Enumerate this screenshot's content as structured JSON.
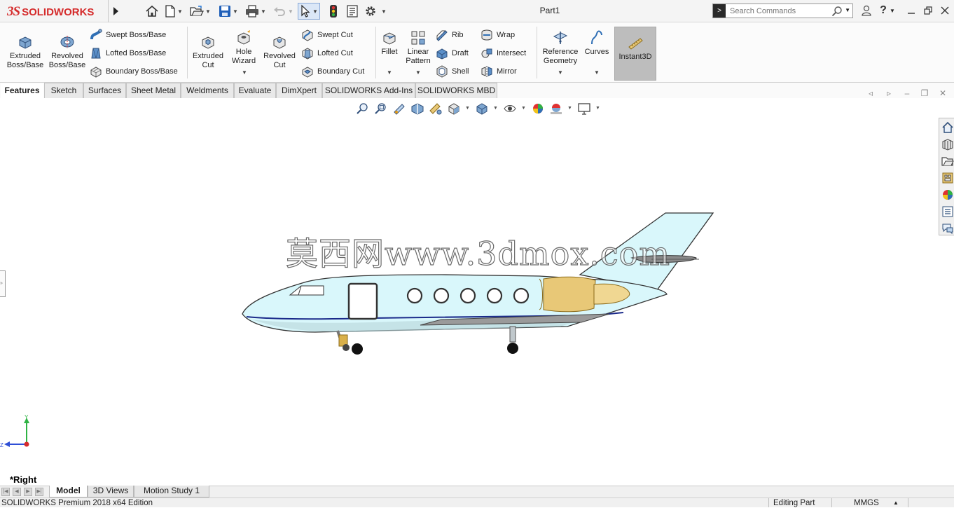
{
  "app": {
    "logo_ds": "3S",
    "logo_text": "SOLIDWORKS",
    "document_title": "Part1"
  },
  "search": {
    "placeholder": "Search Commands"
  },
  "ribbon": {
    "extruded_boss": "Extruded Boss/Base",
    "revolved_boss": "Revolved Boss/Base",
    "swept_boss": "Swept Boss/Base",
    "lofted_boss": "Lofted Boss/Base",
    "boundary_boss": "Boundary Boss/Base",
    "extruded_cut": "Extruded Cut",
    "hole_wizard": "Hole Wizard",
    "revolved_cut": "Revolved Cut",
    "swept_cut": "Swept Cut",
    "lofted_cut": "Lofted Cut",
    "boundary_cut": "Boundary Cut",
    "fillet": "Fillet",
    "linear_pattern": "Linear Pattern",
    "rib": "Rib",
    "draft": "Draft",
    "shell": "Shell",
    "wrap": "Wrap",
    "intersect": "Intersect",
    "mirror": "Mirror",
    "reference_geometry": "Reference Geometry",
    "curves": "Curves",
    "instant3d": "Instant3D"
  },
  "tabs": [
    "Features",
    "Sketch",
    "Surfaces",
    "Sheet Metal",
    "Weldments",
    "Evaluate",
    "DimXpert",
    "SOLIDWORKS Add-Ins",
    "SOLIDWORKS MBD"
  ],
  "graphics": {
    "watermark": "莫西网www.3dmox.com",
    "triad_y": "Y",
    "triad_z": "Z",
    "view_name": "*Right"
  },
  "bottom_tabs": [
    "Model",
    "3D Views",
    "Motion Study 1"
  ],
  "status": {
    "edition": "SOLIDWORKS Premium 2018 x64 Edition",
    "mode": "Editing Part",
    "units": "MMGS"
  },
  "colors": {
    "accent_red": "#d52b2b",
    "fuselage": "#d9f7fb",
    "engine": "#e8c877",
    "stripe": "#1a2a8a"
  }
}
